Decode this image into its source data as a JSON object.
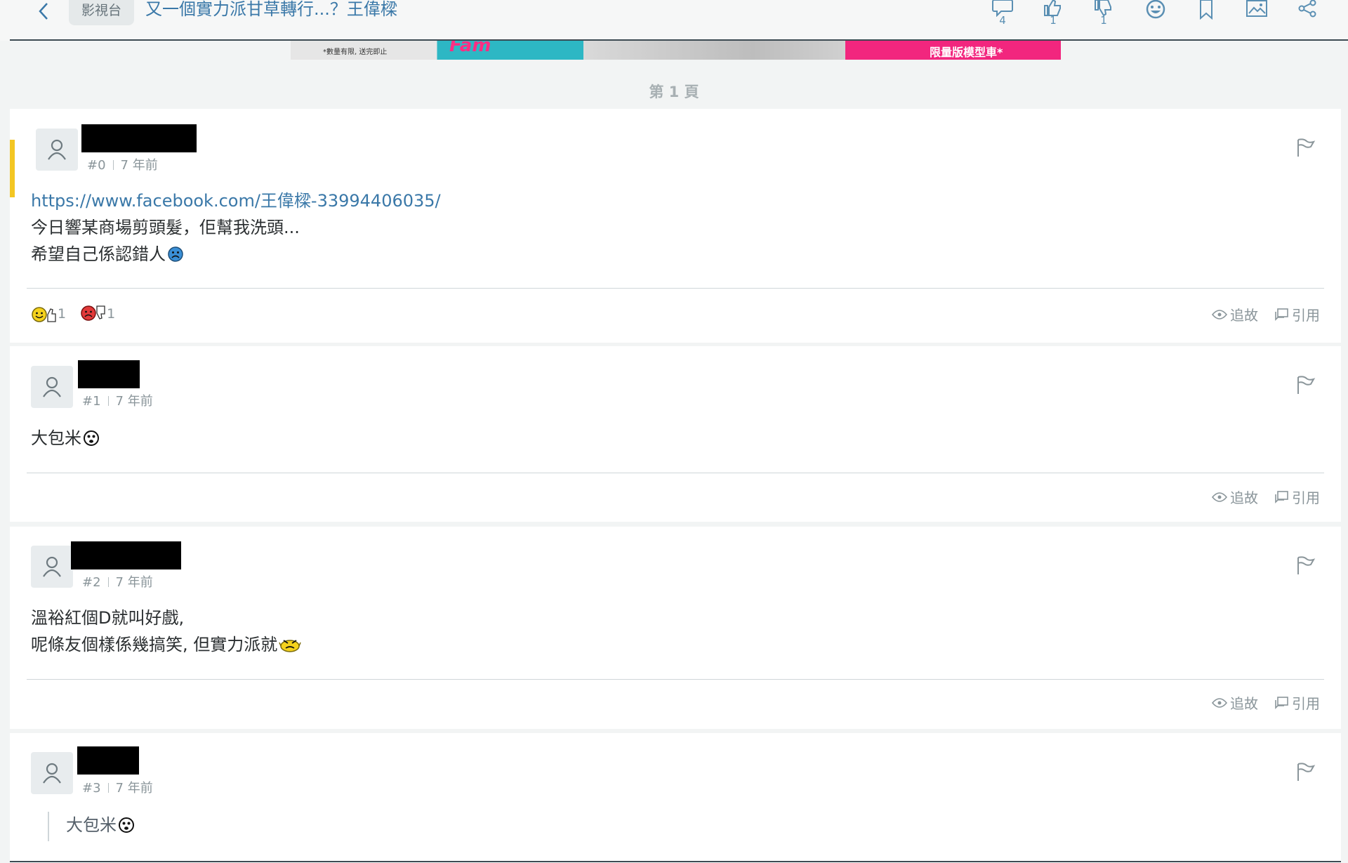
{
  "header": {
    "board": "影視台",
    "title": "又一個實力派甘草轉行...？王偉樑",
    "actions": [
      {
        "icon": "comment-icon",
        "count": "4"
      },
      {
        "icon": "thumbs-up-icon",
        "count": "1"
      },
      {
        "icon": "thumbs-down-icon",
        "count": "1"
      },
      {
        "icon": "emoji-icon",
        "count": ""
      },
      {
        "icon": "bookmark-icon",
        "count": ""
      },
      {
        "icon": "image-icon",
        "count": ""
      },
      {
        "icon": "share-icon",
        "count": ""
      }
    ]
  },
  "banner": {
    "note": "*數量有限, 送完即止",
    "brand": "Fam",
    "promo": "限量版模型車*"
  },
  "page_label": "第 1 頁",
  "posts": [
    {
      "number": "#0",
      "time": "7 年前",
      "lines": [
        "https://www.facebook.com/王偉樑-33994406035/",
        "今日響某商場剪頭髮，佢幫我洗頭...",
        "希望自己係認錯人"
      ],
      "reactions": [
        {
          "icon": "like-smiley-icon",
          "count": "1"
        },
        {
          "icon": "dislike-frown-icon",
          "count": "1"
        }
      ]
    },
    {
      "number": "#1",
      "time": "7 年前",
      "lines": [
        "大包米"
      ]
    },
    {
      "number": "#2",
      "time": "7 年前",
      "lines": [
        "溫裕紅個D就叫好戲,",
        "呢條友個樣係幾搞笑, 但實力派就"
      ]
    },
    {
      "number": "#3",
      "time": "7 年前",
      "quote": "大包米"
    }
  ],
  "post_actions": {
    "follow": "追故",
    "quote": "引用"
  },
  "colors": {
    "accent": "#f3c623",
    "link": "#3a78a8",
    "muted": "#8a959a"
  }
}
